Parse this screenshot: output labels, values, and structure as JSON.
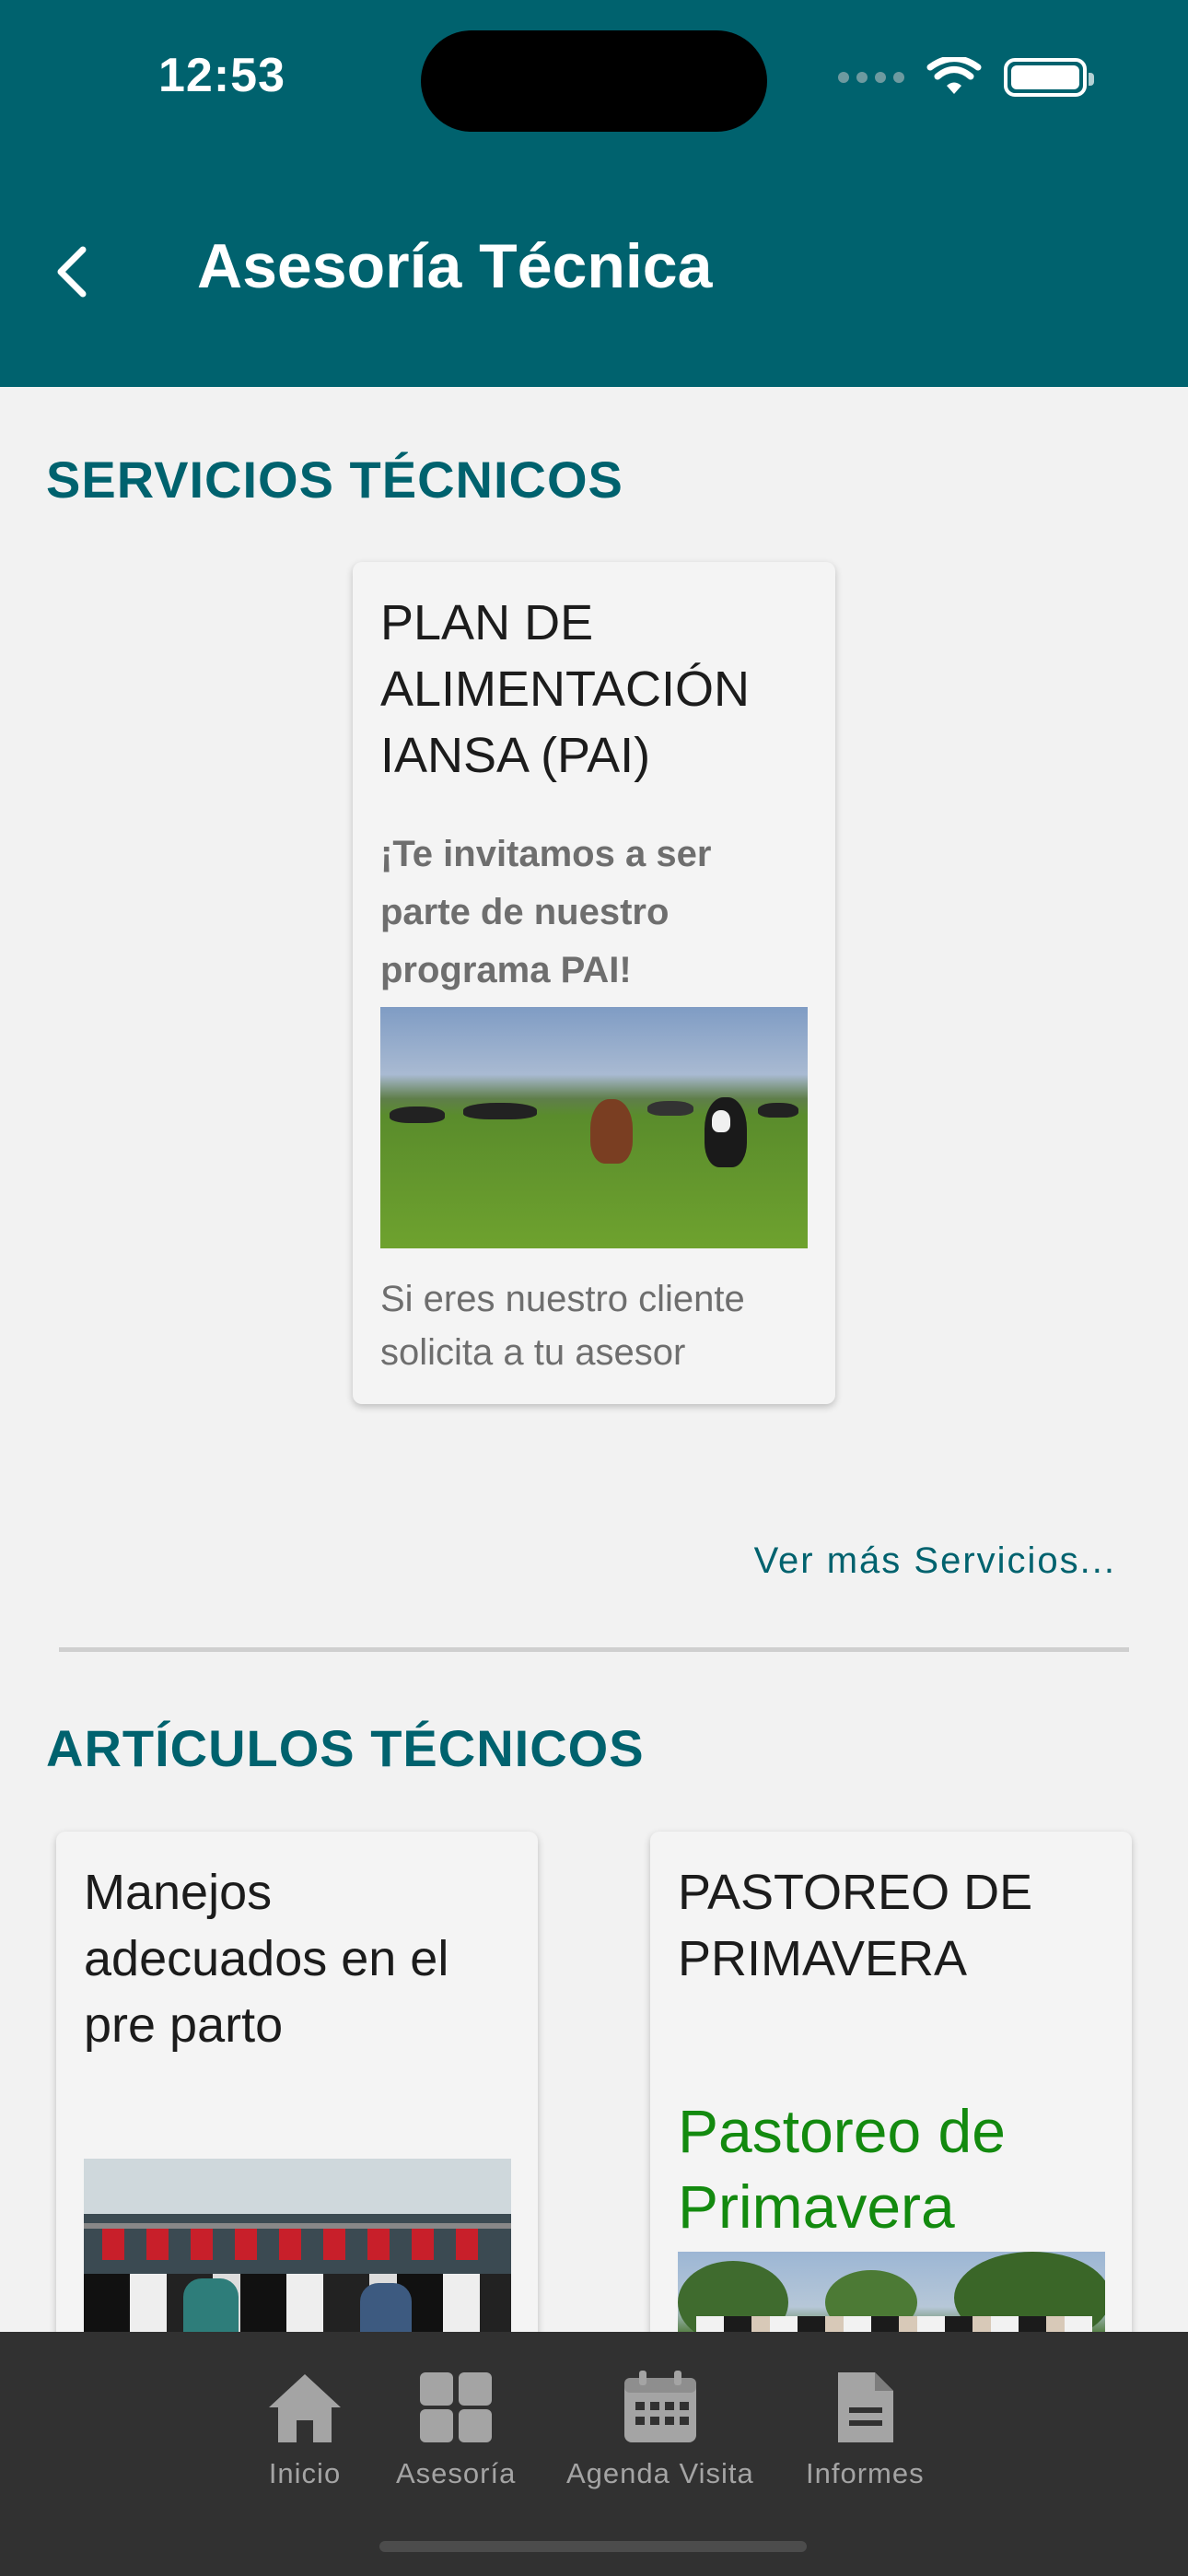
{
  "status_bar": {
    "time": "12:53"
  },
  "header": {
    "title": "Asesoría Técnica"
  },
  "services": {
    "section_title": "SERVICIOS TÉCNICOS",
    "card": {
      "title": "PLAN DE ALIMENTACIÓN IANSA (PAI)",
      "subtitle": "¡Te invitamos a ser parte de nuestro programa PAI!",
      "text": "Si eres nuestro cliente solicita a tu asesor"
    },
    "see_more": "Ver más Servicios..."
  },
  "articles": {
    "section_title": "ARTÍCULOS TÉCNICOS",
    "items": [
      {
        "title": "Manejos adecuados en el pre parto"
      },
      {
        "title": "PASTOREO DE PRIMAVERA",
        "subtitle": "Pastoreo de Primavera"
      }
    ]
  },
  "bottom_nav": {
    "items": [
      {
        "label": "Inicio",
        "icon": "home-icon"
      },
      {
        "label": "Asesoría",
        "icon": "grid-icon"
      },
      {
        "label": "Agenda Visita",
        "icon": "calendar-icon"
      },
      {
        "label": "Informes",
        "icon": "document-icon"
      }
    ]
  },
  "colors": {
    "primary": "#00626e",
    "accent_green": "#138a0f",
    "nav_bg": "#313131"
  }
}
